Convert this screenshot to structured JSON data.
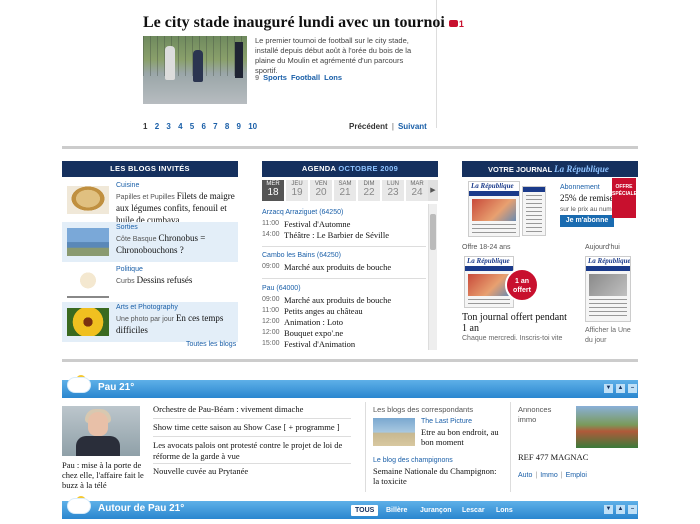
{
  "article": {
    "title": "Le city stade inauguré lundi avec un tournoi",
    "comments": "1",
    "summary": "Le premier tournoi de football sur le city stade, installé depuis début août à l'orée du bois de la plaine du Moulin et agrémenté d'un parcours sportif.",
    "tags_count": "9",
    "tags": [
      "Sports",
      "Football",
      "Lons"
    ]
  },
  "pagination": {
    "pages": [
      "1",
      "2",
      "3",
      "4",
      "5",
      "6",
      "7",
      "8",
      "9",
      "10"
    ],
    "previous": "Précédent",
    "next": "Suivant"
  },
  "blogs": {
    "title": "LES BLOGS INVITÉS",
    "items": [
      {
        "category": "Cuisine",
        "author": "Papilles et Pupilles",
        "headline": "Filets de maigre aux légumes confits, fenouil et huile de cumbava"
      },
      {
        "category": "Sorties",
        "author": "Côte Basque",
        "headline": "Chronobus = Chronobouchons ?"
      },
      {
        "category": "Politique",
        "author": "Curbs",
        "headline": "Dessins refusés"
      },
      {
        "category": "Arts et Photography",
        "author": "Une photo par jour",
        "headline": "En ces temps difficiles"
      }
    ],
    "all_link": "Toutes les blogs"
  },
  "agenda": {
    "title": "AGENDA",
    "month": "OCTOBRE 2009",
    "days": [
      {
        "name": "MER",
        "num": "18"
      },
      {
        "name": "JEU",
        "num": "19"
      },
      {
        "name": "VEN",
        "num": "20"
      },
      {
        "name": "SAM",
        "num": "21"
      },
      {
        "name": "DIM",
        "num": "22"
      },
      {
        "name": "LUN",
        "num": "23"
      },
      {
        "name": "MAR",
        "num": "24"
      }
    ],
    "places": [
      {
        "name": "Arzacq Arraziguet (64250)",
        "events": [
          {
            "time": "11:00",
            "name": "Festival d'Automne"
          },
          {
            "time": "14:00",
            "name": "Théâtre : Le Barbier de Séville"
          }
        ]
      },
      {
        "name": "Cambo les Bains (64250)",
        "events": [
          {
            "time": "09:00",
            "name": "Marché aux produits de bouche"
          }
        ]
      },
      {
        "name": "Pau (64000)",
        "events": [
          {
            "time": "09:00",
            "name": "Marché aux produits de bouche"
          },
          {
            "time": "11:00",
            "name": "Petits anges au château"
          },
          {
            "time": "12:00",
            "name": "Animation : Loto"
          },
          {
            "time": "12:00",
            "name": "Bouquet expo'.ne"
          },
          {
            "time": "15:00",
            "name": "Festival d'Animation"
          }
        ]
      }
    ]
  },
  "journal": {
    "title_prefix": "VOTRE JOURNAL",
    "title_brand": "La République",
    "masthead": "La République",
    "abonnement": "Abonnement",
    "remise": "25% de remise",
    "remise_sub": "sur le prix au numéro",
    "button": "Je m'abonne",
    "ribbon": "OFFRE SPÉCIALE",
    "offre": "Offre 18-24 ans",
    "aujourdhui": "Aujourd'hui",
    "badge": "1 an offert",
    "promo": "Ton journal offert pendant 1 an",
    "promo_sub": "Chaque mercredi. Inscris-toi vite",
    "afficher": "Afficher la Une du jour"
  },
  "pau": {
    "title": "Pau 21°",
    "caption": "Pau : mise à la porte de chez elle, l'affaire fait le buzz à la télé",
    "news": [
      "Orchestre de Pau-Béarn : vivement dimache",
      "Show time cette saison au Show Case [ + programme ]",
      "Les avocats palois ont protesté contre le projet de loi de réforme de la garde à vue",
      "Nouvelle cuvée au Prytanée"
    ],
    "correspondants": {
      "title": "Les blogs des correspondants",
      "items": [
        {
          "category": "The Last Picture",
          "headline": "Etre au bon endroit, au bon moment"
        },
        {
          "category": "Le blog des champignons",
          "headline": "Semaine Nationale du Champignon: la toxicite"
        }
      ]
    },
    "annonces": {
      "title": "Annonces immo",
      "ref": "REF 477 MAGNAC",
      "links": [
        "Auto",
        "Immo",
        "Emploi"
      ]
    }
  },
  "autour": {
    "title": "Autour de Pau 21°",
    "tabs": [
      "TOUS",
      "Billère",
      "Jurançon",
      "Lescar",
      "Lons"
    ]
  }
}
